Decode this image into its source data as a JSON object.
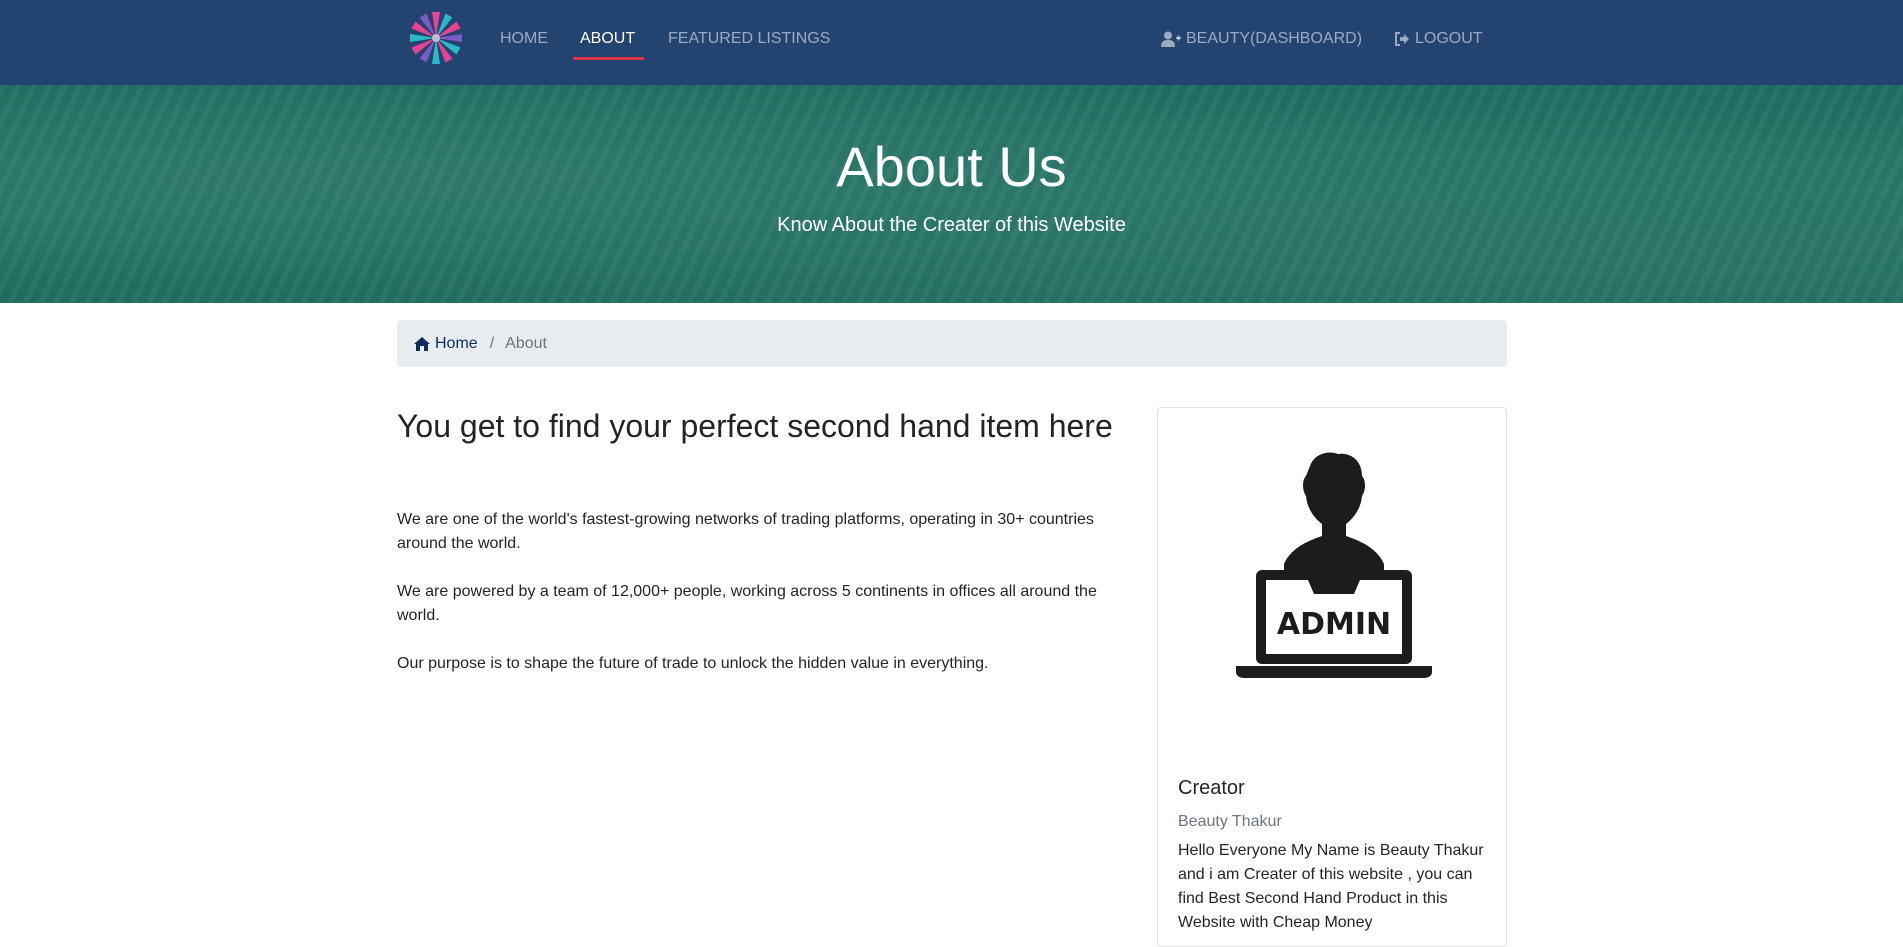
{
  "navbar": {
    "logo": "colorful-star-logo",
    "links": [
      {
        "label": "HOME",
        "active": false
      },
      {
        "label": "ABOUT",
        "active": true
      },
      {
        "label": "FEATURED LISTINGS",
        "active": false
      }
    ],
    "dashboard_label": "BEAUTY(DASHBOARD)",
    "logout_label": "LOGOUT",
    "background_color": "#234370",
    "active_indicator_color": "#dc3545"
  },
  "hero": {
    "title": "About Us",
    "subtitle": "Know About the Creater of this Website",
    "background_color": "#2a7b6c"
  },
  "breadcrumb": {
    "home_label": "Home",
    "separator": "/",
    "current_label": "About"
  },
  "main": {
    "heading": "You get to find your perfect second hand item here",
    "paragraphs": [
      "We are one of the world's fastest-growing networks of trading platforms, operating in 30+ countries around the world.",
      "We are powered by a team of 12,000+ people, working across 5 continents in offices all around the world.",
      "Our purpose is to shape the future of trade to unlock the hidden value in everything."
    ]
  },
  "card": {
    "image_icon": "admin-laptop-avatar",
    "image_label": "ADMIN",
    "title": "Creator",
    "subtitle": "Beauty Thakur",
    "text": "Hello Everyone My Name is Beauty Thakur and i am Creater of this website , you can find Best Second Hand Product in this Website with Cheap Money"
  }
}
